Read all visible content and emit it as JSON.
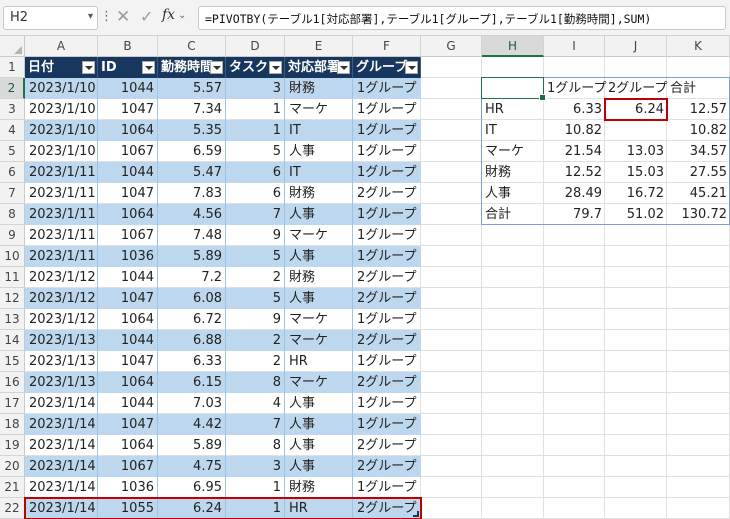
{
  "formula_bar": {
    "name_box": "H2",
    "formula": "=PIVOTBY(テーブル1[対応部署],テーブル1[グループ],テーブル1[勤務時間],SUM)",
    "cancel_glyph": "✕",
    "enter_glyph": "✓",
    "fx_label": "fx"
  },
  "columns": [
    "A",
    "B",
    "C",
    "D",
    "E",
    "F",
    "G",
    "H",
    "I",
    "J",
    "K"
  ],
  "rows": [
    "1",
    "2",
    "3",
    "4",
    "5",
    "6",
    "7",
    "8",
    "9",
    "10",
    "11",
    "12",
    "13",
    "14",
    "15",
    "16",
    "17",
    "18",
    "19",
    "20",
    "21",
    "22"
  ],
  "table": {
    "headers": [
      "日付",
      "ID",
      "勤務時間",
      "タスク",
      "対応部署",
      "グループ"
    ],
    "data": [
      [
        "2023/1/10",
        "1044",
        "5.57",
        "3",
        "財務",
        "1グループ"
      ],
      [
        "2023/1/10",
        "1047",
        "7.34",
        "1",
        "マーケ",
        "1グループ"
      ],
      [
        "2023/1/10",
        "1064",
        "5.35",
        "1",
        "IT",
        "1グループ"
      ],
      [
        "2023/1/10",
        "1067",
        "6.59",
        "5",
        "人事",
        "1グループ"
      ],
      [
        "2023/1/11",
        "1044",
        "5.47",
        "6",
        "IT",
        "1グループ"
      ],
      [
        "2023/1/11",
        "1047",
        "7.83",
        "6",
        "財務",
        "2グループ"
      ],
      [
        "2023/1/11",
        "1064",
        "4.56",
        "7",
        "人事",
        "1グループ"
      ],
      [
        "2023/1/11",
        "1067",
        "7.48",
        "9",
        "マーケ",
        "1グループ"
      ],
      [
        "2023/1/11",
        "1036",
        "5.89",
        "5",
        "人事",
        "1グループ"
      ],
      [
        "2023/1/12",
        "1044",
        "7.2",
        "2",
        "財務",
        "2グループ"
      ],
      [
        "2023/1/12",
        "1047",
        "6.08",
        "5",
        "人事",
        "2グループ"
      ],
      [
        "2023/1/12",
        "1064",
        "6.72",
        "9",
        "マーケ",
        "1グループ"
      ],
      [
        "2023/1/13",
        "1044",
        "6.88",
        "2",
        "マーケ",
        "2グループ"
      ],
      [
        "2023/1/13",
        "1047",
        "6.33",
        "2",
        "HR",
        "1グループ"
      ],
      [
        "2023/1/13",
        "1064",
        "6.15",
        "8",
        "マーケ",
        "2グループ"
      ],
      [
        "2023/1/14",
        "1044",
        "7.03",
        "4",
        "人事",
        "1グループ"
      ],
      [
        "2023/1/14",
        "1047",
        "4.42",
        "7",
        "人事",
        "1グループ"
      ],
      [
        "2023/1/14",
        "1064",
        "5.89",
        "8",
        "人事",
        "2グループ"
      ],
      [
        "2023/1/14",
        "1067",
        "4.75",
        "3",
        "人事",
        "2グループ"
      ],
      [
        "2023/1/14",
        "1036",
        "6.95",
        "1",
        "財務",
        "1グループ"
      ],
      [
        "2023/1/14",
        "1055",
        "6.24",
        "1",
        "HR",
        "2グループ"
      ]
    ]
  },
  "pivot": {
    "header": [
      "",
      "1グループ",
      "2グループ",
      "合計"
    ],
    "rows": [
      [
        "HR",
        "6.33",
        "6.24",
        "12.57"
      ],
      [
        "IT",
        "10.82",
        "",
        "10.82"
      ],
      [
        "マーケ",
        "21.54",
        "13.03",
        "34.57"
      ],
      [
        "財務",
        "12.52",
        "15.03",
        "27.55"
      ],
      [
        "人事",
        "28.49",
        "16.72",
        "45.21"
      ],
      [
        "合計",
        "79.7",
        "51.02",
        "130.72"
      ]
    ]
  },
  "colors": {
    "table_header": "#17375e",
    "band_row": "#bdd7ee",
    "highlight_border": "#c00000",
    "pivot_border": "#7aa0d4",
    "selection": "#1e7145"
  }
}
